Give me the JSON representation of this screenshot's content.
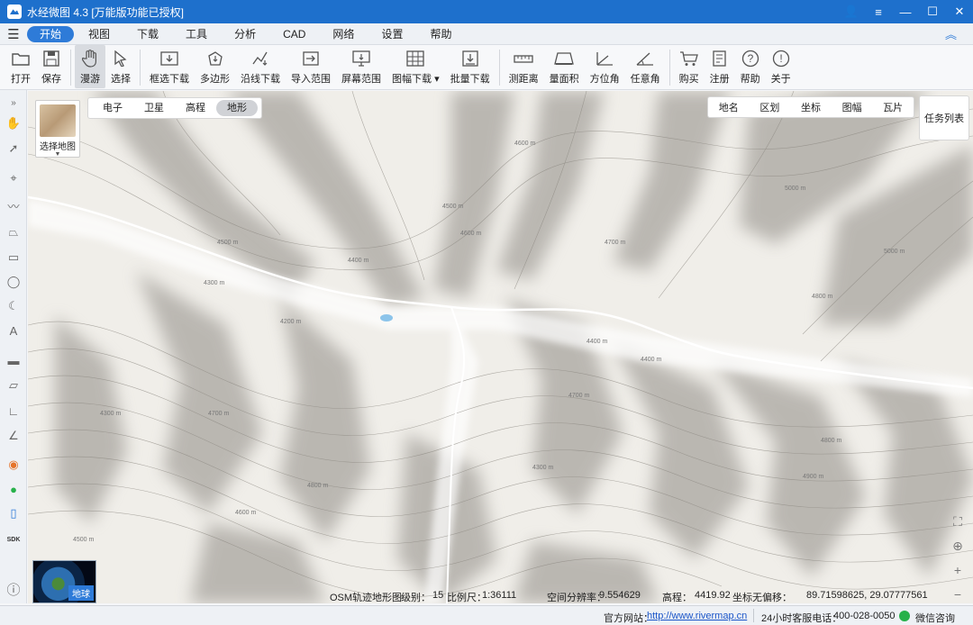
{
  "window": {
    "title": "水经微图 4.3 [万能版功能已授权]",
    "controls": {
      "user": "👤",
      "menu": "≡",
      "minimize": "—",
      "maximize": "☐",
      "close": "✕"
    }
  },
  "menu": {
    "items": [
      {
        "label": "开始",
        "active": true
      },
      {
        "label": "视图"
      },
      {
        "label": "下载"
      },
      {
        "label": "工具"
      },
      {
        "label": "分析"
      },
      {
        "label": "CAD"
      },
      {
        "label": "网络"
      },
      {
        "label": "设置"
      },
      {
        "label": "帮助"
      }
    ]
  },
  "toolbar": {
    "open": "打开",
    "save": "保存",
    "pan": "漫游",
    "select": "选择",
    "box_download": "框选下载",
    "polygon": "多边形",
    "line_download": "沿线下载",
    "import_range": "导入范围",
    "screen_range": "屏幕范围",
    "sheet_download": "图幅下载",
    "batch_download": "批量下载",
    "measure_distance": "测距离",
    "measure_area": "量面积",
    "azimuth": "方位角",
    "any_angle": "任意角",
    "buy": "购买",
    "register": "注册",
    "help": "帮助",
    "about": "关于"
  },
  "map": {
    "switcher_label": "选择地图",
    "types": [
      {
        "label": "电子"
      },
      {
        "label": "卫星"
      },
      {
        "label": "高程"
      },
      {
        "label": "地形",
        "active": true
      }
    ],
    "search_tabs": [
      "地名",
      "区划",
      "坐标",
      "图幅",
      "瓦片"
    ],
    "task_list": "任务列表",
    "globe_label": "地球",
    "contour_labels": [
      "4500 m",
      "4400 m",
      "4300 m",
      "4200 m",
      "4600 m",
      "4700 m",
      "4800 m",
      "5000 m",
      "4900 m"
    ]
  },
  "info": {
    "map_name": "OSM轨迹地形图",
    "level_label": "级别：",
    "level": "15",
    "scale_label": "比例尺：",
    "scale": "1:36111",
    "resolution_label": "空间分辨率：",
    "resolution": "9.554629",
    "elevation_label": "高程：",
    "elevation": "4419.92",
    "coord_label": "坐标无偏移：",
    "coords": "89.71598625, 29.07777561"
  },
  "status": {
    "website_label": "官方网站：",
    "website_url": "http://www.rivermap.cn",
    "hotline_label": "24小时客服电话：",
    "hotline": "400-028-0050",
    "wechat": "微信咨询"
  },
  "sidebar": {
    "sdk_label": "SDK"
  },
  "colors": {
    "accent": "#1e70cc",
    "active_menu": "#2e7bd8",
    "link": "#1a55c9",
    "water": "#8cc4ea"
  }
}
